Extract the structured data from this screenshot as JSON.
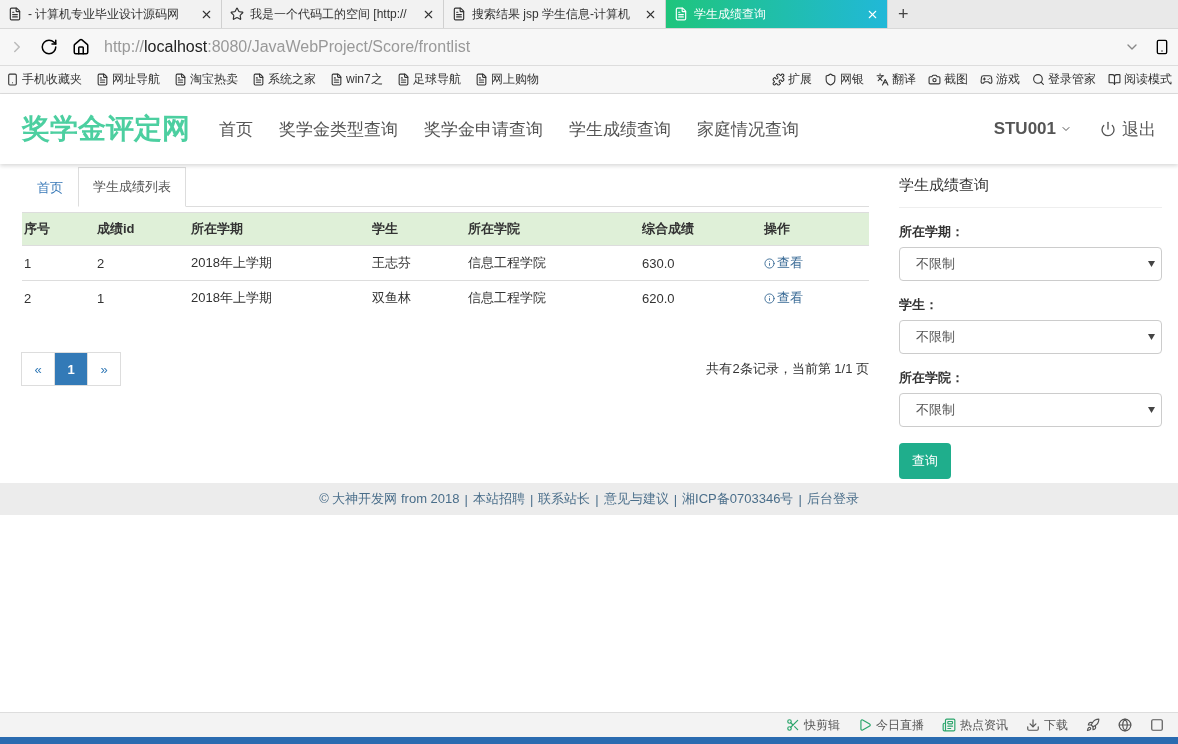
{
  "browser": {
    "tabs": [
      {
        "title": "- 计算机专业毕业设计源码网",
        "selected": false
      },
      {
        "title": "我是一个代码工的空间 [http://",
        "selected": false
      },
      {
        "title": "搜索结果 jsp 学生信息-计算机",
        "selected": false
      },
      {
        "title": "学生成绩查询",
        "selected": true
      }
    ],
    "new_tab": "+",
    "address": {
      "scheme": "http://",
      "host": "localhost",
      "path": ":8080/JavaWebProject/Score/frontlist"
    },
    "bookmarks": [
      {
        "label": "手机收藏夹"
      },
      {
        "label": "网址导航"
      },
      {
        "label": "淘宝热卖"
      },
      {
        "label": "系统之家"
      },
      {
        "label": "win7之"
      },
      {
        "label": "足球导航"
      },
      {
        "label": "网上购物"
      }
    ],
    "extensions": [
      {
        "label": "扩展"
      },
      {
        "label": "网银"
      },
      {
        "label": "翻译"
      },
      {
        "label": "截图"
      },
      {
        "label": "游戏"
      },
      {
        "label": "登录管家"
      },
      {
        "label": "阅读模式"
      }
    ]
  },
  "site": {
    "brand": "奖学金评定网",
    "nav": [
      {
        "label": "首页"
      },
      {
        "label": "奖学金类型查询"
      },
      {
        "label": "奖学金申请查询"
      },
      {
        "label": "学生成绩查询"
      },
      {
        "label": "家庭情况查询"
      }
    ],
    "user": "STU001",
    "logout": "退出"
  },
  "breadcrumb": [
    {
      "label": "首页",
      "selected": false
    },
    {
      "label": "学生成绩列表",
      "selected": true
    }
  ],
  "table": {
    "columns": [
      "序号",
      "成绩id",
      "所在学期",
      "学生",
      "所在学院",
      "综合成绩",
      "操作"
    ],
    "rows": [
      [
        "1",
        "2",
        "2018年上学期",
        "王志芬",
        "信息工程学院",
        "630.0",
        "查看"
      ],
      [
        "2",
        "1",
        "2018年上学期",
        "双鱼林",
        "信息工程学院",
        "620.0",
        "查看"
      ]
    ]
  },
  "pagination": {
    "prev": "«",
    "pages": [
      {
        "label": "1",
        "selected": true
      }
    ],
    "next": "»",
    "summary": "共有2条记录，当前第 1/1 页"
  },
  "sidebar": {
    "title": "学生成绩查询",
    "filters": [
      {
        "label": "所在学期：",
        "value": "不限制"
      },
      {
        "label": "学生：",
        "value": "不限制"
      },
      {
        "label": "所在学院：",
        "value": "不限制"
      }
    ],
    "button": "查询"
  },
  "footer": {
    "copyright": "© 大神开发网 from 2018",
    "separator": "|",
    "links": [
      "本站招聘",
      "联系站长",
      "意见与建议",
      "湘ICP备0703346号",
      "后台登录"
    ]
  },
  "status_bar": [
    {
      "label": "快剪辑"
    },
    {
      "label": "今日直播"
    },
    {
      "label": "热点资讯"
    },
    {
      "label": "下载"
    }
  ]
}
